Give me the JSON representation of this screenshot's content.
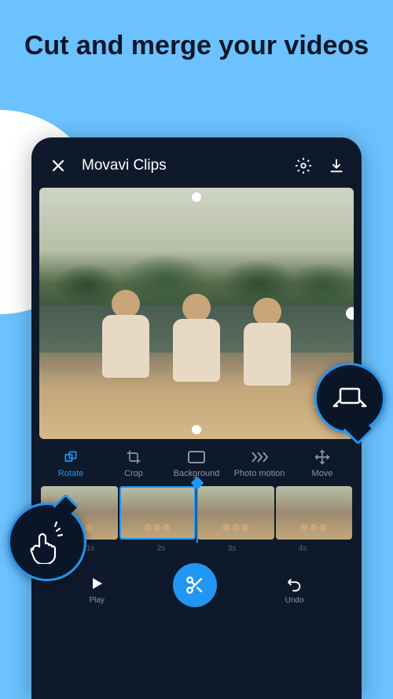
{
  "headline": "Cut and merge your videos",
  "app": {
    "title": "Movavi Clips"
  },
  "tools": [
    {
      "label": "Rotate",
      "icon": "rotate-icon"
    },
    {
      "label": "Crop",
      "icon": "crop-icon"
    },
    {
      "label": "Background",
      "icon": "background-icon"
    },
    {
      "label": "Photo motion",
      "icon": "motion-icon"
    },
    {
      "label": "Move",
      "icon": "move-icon"
    }
  ],
  "timeline": {
    "ticks": [
      "1s",
      "2s",
      "3s",
      "4s"
    ]
  },
  "controls": {
    "play": "Play",
    "undo": "Undo"
  }
}
